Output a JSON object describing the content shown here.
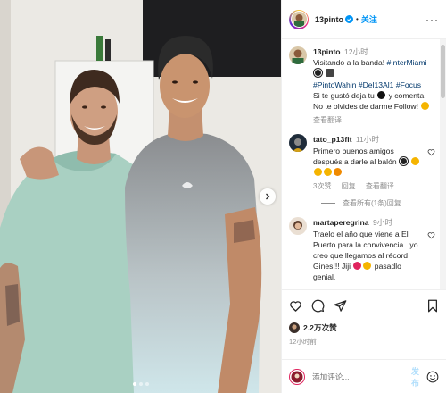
{
  "post": {
    "author": "13pinto",
    "follow_label": "关注",
    "separator": "•",
    "more_label": "···",
    "photo_desc": "two-men-posing-selfie"
  },
  "caption": {
    "username": "13pinto",
    "time": "12小时",
    "line1": "Visitando a la banda! ",
    "tag1": "#InterMiami",
    "line2_tags": "#PintoWahin #Del13Al1 #Focus",
    "line3": "Si te gustó deja tu ",
    "line3b": " y comenta!",
    "line4": "No te olvides de darme Follow!",
    "translate": "查看翻译"
  },
  "comments": [
    {
      "username": "tato_p13fit",
      "time": "11小时",
      "text": "Primero buenos amigos después a darle al balón",
      "likes": "3次赞",
      "reply": "回复",
      "translate": "查看翻译"
    },
    {
      "username": "martaperegrina",
      "time": "9小时",
      "text": "Traelo el año que viene a El Puerto para la convivencia...yo creo que llegamos al récord Gines!!! Jiji",
      "text_end": " pasadlo genial."
    }
  ],
  "view_replies": "查看所有(1条)回复",
  "actions": {
    "like": "like-icon",
    "comment": "comment-icon",
    "share": "share-icon",
    "save": "save-icon"
  },
  "likes_label": "2.2万次赞",
  "posted_time": "12小时前",
  "add_comment": {
    "placeholder": "添加评论...",
    "post_label": "发布"
  },
  "colors": {
    "link": "#0095f6",
    "hashtag": "#00376b",
    "muted": "#8e8e8e"
  }
}
